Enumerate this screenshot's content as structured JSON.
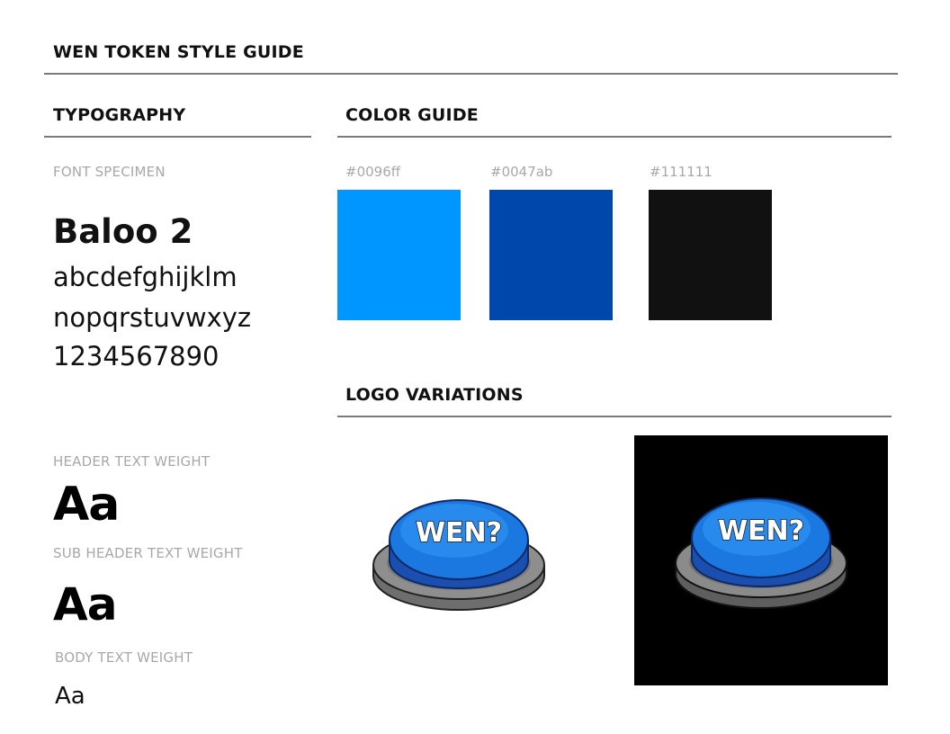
{
  "header": {
    "title": "WEN TOKEN STYLE GUIDE"
  },
  "typography": {
    "heading": "TYPOGRAPHY",
    "specimen_caption": "FONT SPECIMEN",
    "font_name": "Baloo 2",
    "lines": [
      "abcdefghijklm",
      "nopqrstuvwxyz",
      "1234567890"
    ],
    "header_weight_caption": "HEADER TEXT WEIGHT",
    "header_sample": "Aa",
    "subheader_weight_caption": "SUB HEADER TEXT WEIGHT",
    "subheader_sample": "Aa",
    "body_weight_caption": "BODY TEXT WEIGHT",
    "body_sample": "Aa"
  },
  "colors": {
    "heading": "COLOR GUIDE",
    "swatches": [
      {
        "hex": "#0096ff",
        "color": "#0096ff"
      },
      {
        "hex": "#0047ab",
        "color": "#0047ab"
      },
      {
        "hex": "#111111",
        "color": "#111111"
      }
    ]
  },
  "logos": {
    "heading": "LOGO VARIATIONS",
    "logo_text": "WEN?",
    "dark_background": "#000000"
  }
}
